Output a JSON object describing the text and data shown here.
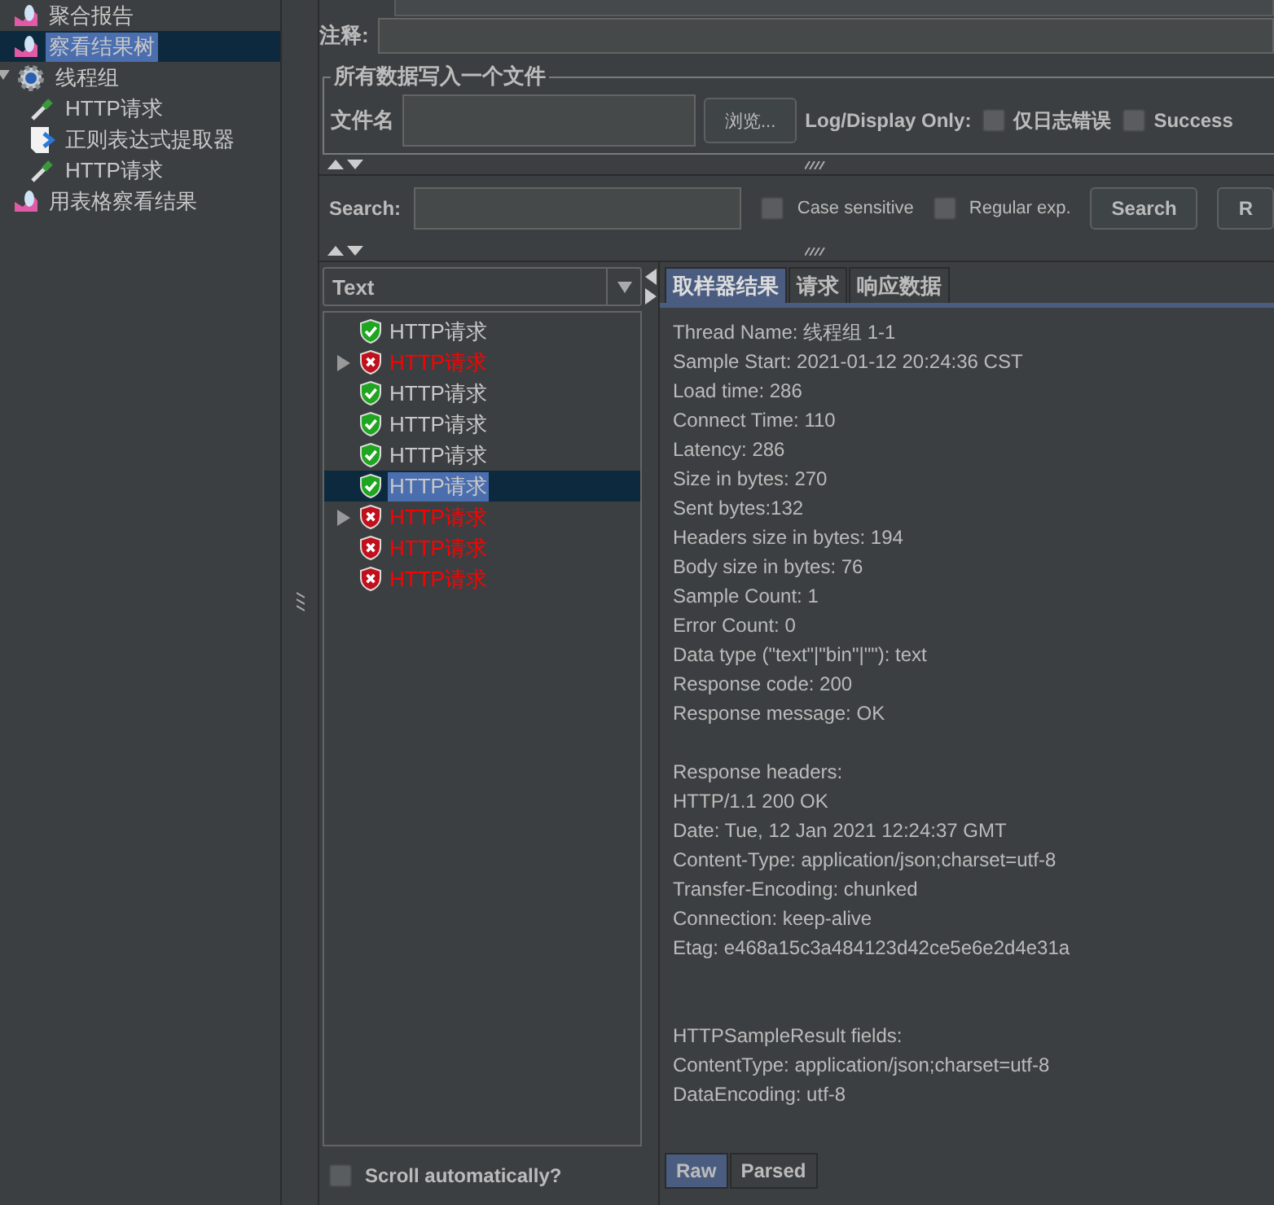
{
  "tree": [
    {
      "label": "聚合报告",
      "kind": "report",
      "selected": false
    },
    {
      "label": "察看结果树",
      "kind": "report",
      "selected": true
    },
    {
      "label": "线程组",
      "kind": "thread-group",
      "selected": false,
      "expanded": true,
      "children": [
        {
          "label": "HTTP请求",
          "kind": "sampler",
          "selected": false
        },
        {
          "label": "正则表达式提取器",
          "kind": "extractor",
          "selected": false
        },
        {
          "label": "HTTP请求",
          "kind": "sampler",
          "selected": false
        }
      ]
    },
    {
      "label": "用表格察看结果",
      "kind": "report",
      "selected": false
    }
  ],
  "comment": {
    "label": "注释:"
  },
  "file_group": {
    "title": "所有数据写入一个文件",
    "file_label": "文件名",
    "browse": "浏览...",
    "log_label": "Log/Display Only:",
    "options": [
      {
        "label": "仅日志错误",
        "checked": false
      },
      {
        "label": "Success",
        "checked": false
      }
    ]
  },
  "search": {
    "label": "Search:",
    "options": [
      {
        "label": "Case sensitive",
        "checked": false
      },
      {
        "label": "Regular exp.",
        "checked": false
      }
    ],
    "buttons": [
      "Search",
      "R"
    ]
  },
  "renderer": {
    "value": "Text"
  },
  "results": [
    {
      "label": "HTTP请求",
      "passed": true,
      "expandable": false,
      "selected": false
    },
    {
      "label": "HTTP请求",
      "passed": false,
      "expandable": true,
      "selected": false
    },
    {
      "label": "HTTP请求",
      "passed": true,
      "expandable": false,
      "selected": false
    },
    {
      "label": "HTTP请求",
      "passed": true,
      "expandable": false,
      "selected": false
    },
    {
      "label": "HTTP请求",
      "passed": true,
      "expandable": false,
      "selected": false
    },
    {
      "label": "HTTP请求",
      "passed": true,
      "expandable": false,
      "selected": true
    },
    {
      "label": "HTTP请求",
      "passed": false,
      "expandable": true,
      "selected": false
    },
    {
      "label": "HTTP请求",
      "passed": false,
      "expandable": false,
      "selected": false
    },
    {
      "label": "HTTP请求",
      "passed": false,
      "expandable": false,
      "selected": false
    }
  ],
  "scroll_auto": {
    "label": "Scroll automatically?",
    "checked": false
  },
  "tabs": [
    {
      "label": "取样器结果",
      "selected": true
    },
    {
      "label": "请求",
      "selected": false
    },
    {
      "label": "响应数据",
      "selected": false
    }
  ],
  "sections": [
    {
      "kind": "sampler",
      "lines": [
        "Thread Name: 线程组 1-1",
        "Sample Start: 2021-01-12 20:24:36 CST",
        "Load time: 286",
        "Connect Time: 110",
        "Latency: 286",
        "Size in bytes: 270",
        "Sent bytes:132",
        "Headers size in bytes: 194",
        "Body size in bytes: 76",
        "Sample Count: 1",
        "Error Count: 0",
        "Data type (\"text\"|\"bin\"|\"\"): text",
        "Response code: 200",
        "Response message: OK"
      ]
    },
    {
      "kind": "headers",
      "lines": [
        "Response headers:",
        "HTTP/1.1 200 OK",
        "Date: Tue, 12 Jan 2021 12:24:37 GMT",
        "Content-Type: application/json;charset=utf-8",
        "Transfer-Encoding: chunked",
        "Connection: keep-alive",
        "Etag: e468a15c3a484123d42ce5e6e2d4e31a"
      ]
    },
    {
      "kind": "fields",
      "lines": [
        "HTTPSampleResult fields:",
        "ContentType: application/json;charset=utf-8",
        "DataEncoding: utf-8"
      ]
    }
  ],
  "view_tabs": [
    {
      "label": "Raw",
      "selected": true
    },
    {
      "label": "Parsed",
      "selected": false
    }
  ]
}
